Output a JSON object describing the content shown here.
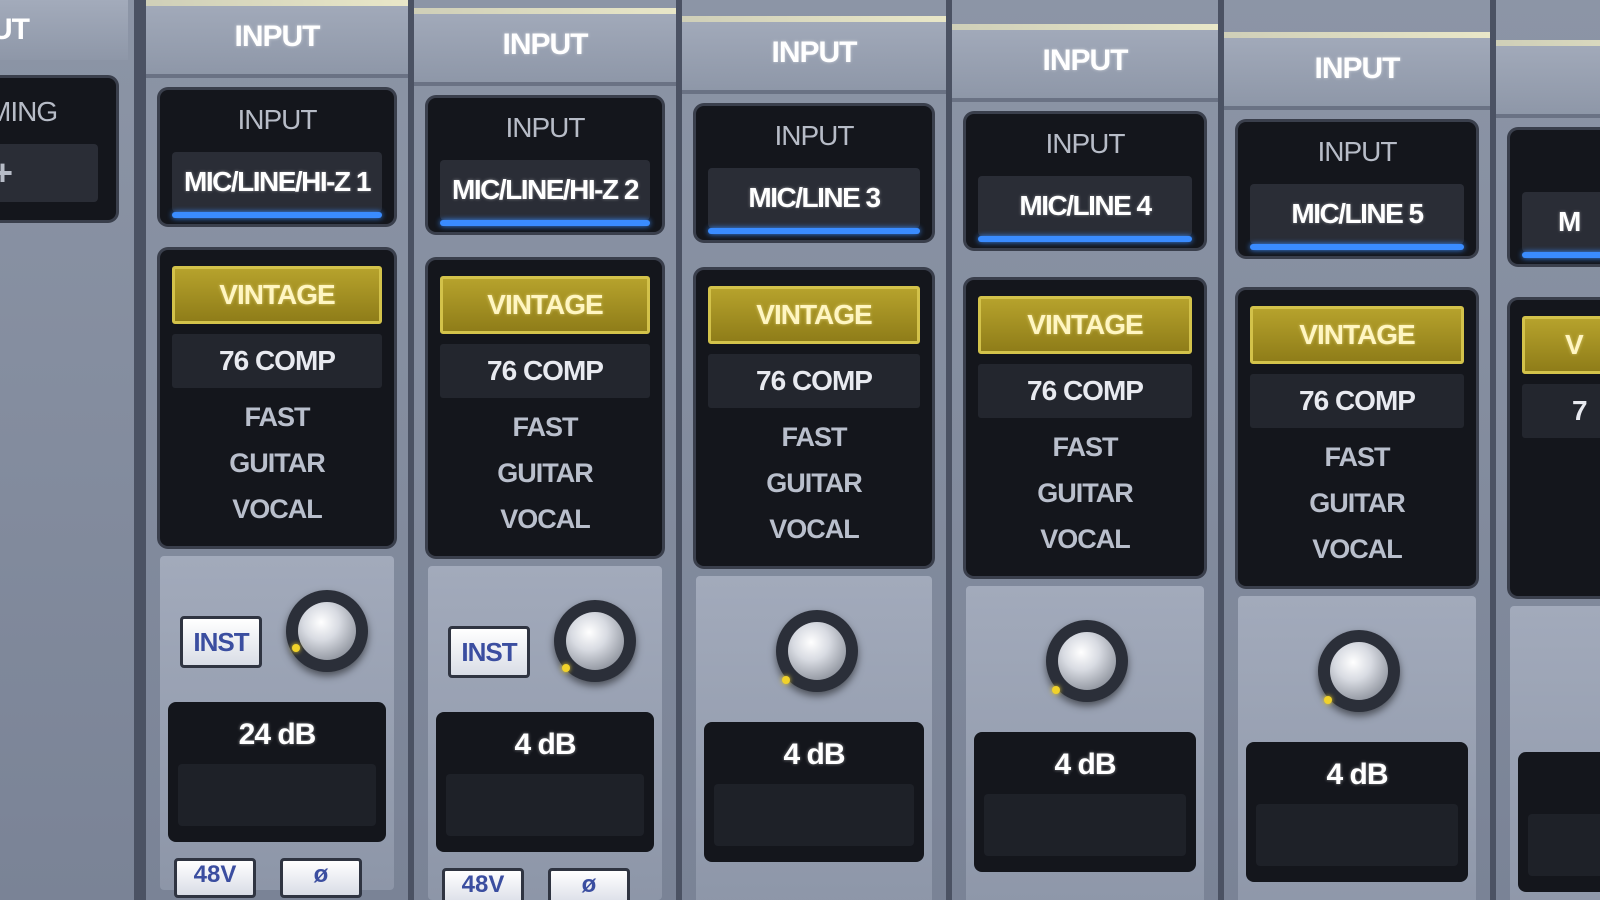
{
  "left_strip": {
    "header": "PUT",
    "box_label": "MING",
    "add_icon": "plus-icon"
  },
  "channels": [
    {
      "header": "INPUT",
      "input_label": "INPUT",
      "input_source": "MIC/LINE/HI-Z 1",
      "plugin": "VINTAGE",
      "preset": "76 COMP",
      "preset_items": [
        "FAST",
        "GUITAR",
        "VOCAL"
      ],
      "inst": "INST",
      "gain": "24 dB",
      "btn_48v": "48V",
      "btn_phase": "ø"
    },
    {
      "header": "INPUT",
      "input_label": "INPUT",
      "input_source": "MIC/LINE/HI-Z 2",
      "plugin": "VINTAGE",
      "preset": "76 COMP",
      "preset_items": [
        "FAST",
        "GUITAR",
        "VOCAL"
      ],
      "inst": "INST",
      "gain": "4 dB",
      "btn_48v": "48V",
      "btn_phase": "ø"
    },
    {
      "header": "INPUT",
      "input_label": "INPUT",
      "input_source": "MIC/LINE 3",
      "plugin": "VINTAGE",
      "preset": "76 COMP",
      "preset_items": [
        "FAST",
        "GUITAR",
        "VOCAL"
      ],
      "gain": "4 dB"
    },
    {
      "header": "INPUT",
      "input_label": "INPUT",
      "input_source": "MIC/LINE 4",
      "plugin": "VINTAGE",
      "preset": "76 COMP",
      "preset_items": [
        "FAST",
        "GUITAR",
        "VOCAL"
      ],
      "gain": "4 dB"
    },
    {
      "header": "INPUT",
      "input_label": "INPUT",
      "input_source": "MIC/LINE 5",
      "plugin": "VINTAGE",
      "preset": "76 COMP",
      "preset_items": [
        "FAST",
        "GUITAR",
        "VOCAL"
      ],
      "gain": "4 dB"
    },
    {
      "header": "",
      "input_label": "",
      "input_source": "M",
      "plugin": "V",
      "preset": "7",
      "preset_items": [
        "",
        "",
        ""
      ],
      "gain": ""
    }
  ],
  "colors": {
    "accent_blue": "#3a8cff",
    "plugin_gold": "#b6a22c",
    "knob_indicator": "#f1d22a"
  }
}
